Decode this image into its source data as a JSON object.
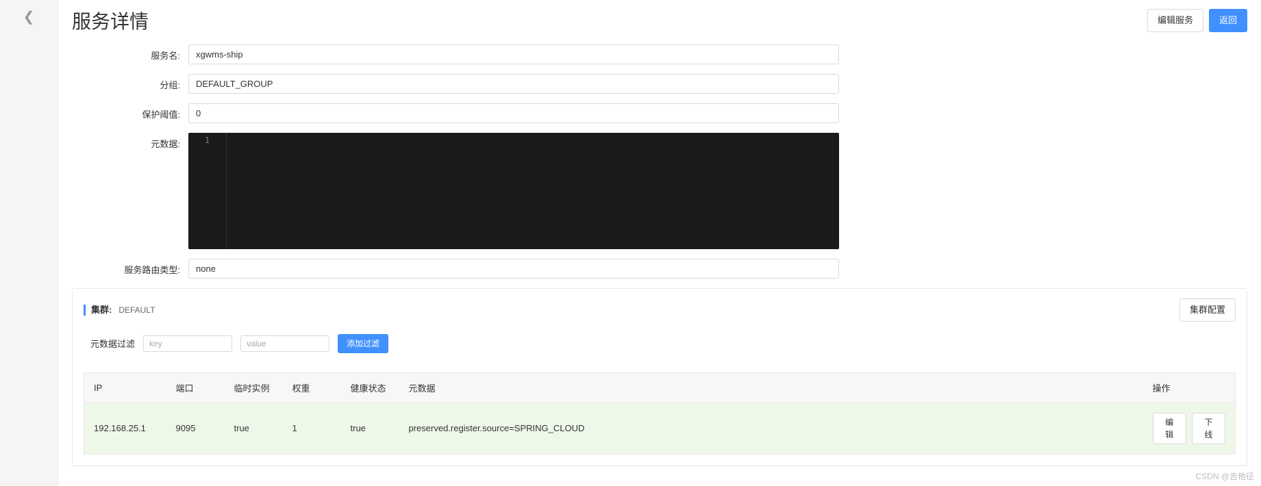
{
  "header": {
    "title": "服务详情",
    "edit_button": "编辑服务",
    "back_button": "返回"
  },
  "form": {
    "service_name_label": "服务名:",
    "service_name_value": "xgwms-ship",
    "group_label": "分组:",
    "group_value": "DEFAULT_GROUP",
    "threshold_label": "保护阈值:",
    "threshold_value": "0",
    "metadata_label": "元数据:",
    "metadata_line_number": "1",
    "route_type_label": "服务路由类型:",
    "route_type_value": "none"
  },
  "cluster": {
    "label": "集群:",
    "value": "DEFAULT",
    "config_button": "集群配置",
    "filter": {
      "label": "元数据过滤",
      "key_placeholder": "key",
      "value_placeholder": "value",
      "add_button": "添加过滤"
    },
    "table": {
      "headers": {
        "ip": "IP",
        "port": "端口",
        "ephemeral": "临时实例",
        "weight": "权重",
        "healthy": "健康状态",
        "metadata": "元数据",
        "ops": "操作"
      },
      "rows": [
        {
          "ip": "192.168.25.1",
          "port": "9095",
          "ephemeral": "true",
          "weight": "1",
          "healthy": "true",
          "metadata": "preserved.register.source=SPRING_CLOUD",
          "edit": "编辑",
          "offline": "下线"
        }
      ]
    }
  },
  "watermark": "CSDN @吉他征"
}
